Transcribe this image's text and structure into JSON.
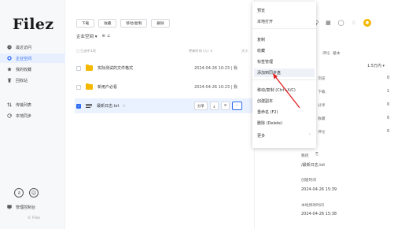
{
  "app": {
    "logo": "Filez",
    "copyright": "© Filez"
  },
  "window_controls": [
    "C",
    "⊖",
    "–",
    "□",
    "×"
  ],
  "sidebar": {
    "items": [
      {
        "label": "最近访问",
        "icon": "clock-icon"
      },
      {
        "label": "企业空间",
        "icon": "building-icon",
        "active": true
      },
      {
        "label": "我的收藏",
        "icon": "star-icon"
      },
      {
        "label": "回收站",
        "icon": "trash-icon"
      },
      {
        "label": "传输列表",
        "icon": "transfer-icon"
      },
      {
        "label": "本地同步",
        "icon": "sync-icon"
      }
    ],
    "bottom": {
      "manage_label": "管理控制台"
    }
  },
  "toolbar": {
    "buttons": [
      "下载",
      "收藏",
      "移动/复制",
      "删除"
    ]
  },
  "breadcrumb": {
    "label": "企业空间 ▾",
    "extra": "⊕ ∠"
  },
  "list": {
    "headers": {
      "name": "□ 已选中1项",
      "modified": "更新时间 (人) ↕",
      "size": "大小"
    },
    "rows": [
      {
        "name": "实际测试的文件格式",
        "date": "2024-04-26 10:23 | 我",
        "type": "folder"
      },
      {
        "name": "新用户必看",
        "date": "2024-04-26 10:23 | 我",
        "type": "folder"
      },
      {
        "name": "最新日志.txt",
        "star": "☆",
        "type": "doc",
        "selected": true,
        "actions": [
          "分享",
          "⤓",
          "⊙",
          "···"
        ]
      }
    ]
  },
  "right_panel": {
    "tabs": [
      "评论",
      "基本"
    ],
    "version": "1.5万内 ▾",
    "stats": [
      {
        "label": "浏览",
        "value": "0"
      },
      {
        "label": "下载",
        "value": "1"
      },
      {
        "label": "分享",
        "value": "0"
      },
      {
        "label": "收藏",
        "value": "0"
      },
      {
        "label": "评论",
        "value": "0"
      }
    ],
    "path_label": "路径",
    "path_value": "/最新日志.txt",
    "created_label": "创建时间",
    "created_value": "2024-04-26 15:39",
    "modified_label": "本地修改时间",
    "modified_value": "2024-04-26 15:38"
  },
  "context_menu": {
    "items": [
      "预览",
      "本地打开",
      "复制",
      "收藏",
      "标签管理",
      "添加到同步盘",
      "移动/复制 (Ctrl+X/C)",
      "创建副本",
      "重命名 (F2)",
      "删除 (Delete)",
      "更多"
    ],
    "highlighted_index": 5,
    "more_arrow": "›"
  },
  "colors": {
    "accent": "#2d6bf5",
    "folder": "#f5b800",
    "arrow": "#e02020"
  }
}
